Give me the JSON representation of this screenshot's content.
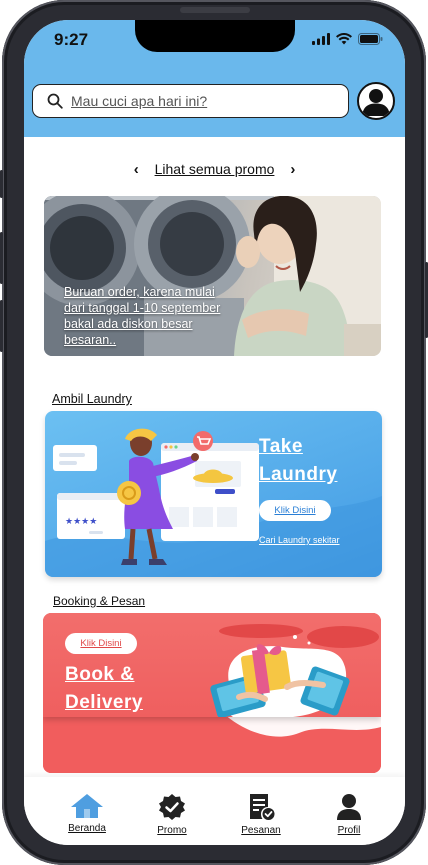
{
  "status_bar": {
    "time": "9:27"
  },
  "search": {
    "placeholder": "Mau cuci apa hari ini?"
  },
  "promo_nav": {
    "label": "Lihat semua promo",
    "prev": "‹",
    "next": "›"
  },
  "promo_banner": {
    "text": "Buruan order, karena mulai dari tanggal 1-10 september bakal ada diskon besar besaran.."
  },
  "sections": {
    "ambil": "Ambil Laundry",
    "booking": "Booking & Pesan"
  },
  "take_card": {
    "title_line1": "Take",
    "title_line2": "Laundry",
    "button": "Klik Disini",
    "link": "Cari Laundry sekitar"
  },
  "book_card": {
    "button": "Klik Disini",
    "title_line1": "Book &",
    "title_line2": "Delivery"
  },
  "bottom_nav": {
    "items": [
      {
        "label": "Beranda",
        "icon": "home-icon",
        "active": true
      },
      {
        "label": "Promo",
        "icon": "promo-badge-icon"
      },
      {
        "label": "Pesanan",
        "icon": "receipt-icon"
      },
      {
        "label": "Profil",
        "icon": "user-icon"
      }
    ]
  },
  "colors": {
    "header": "#6ab8ec",
    "take_card": "#4fa6e8",
    "book_card": "#f15d5d",
    "nav_active": "#4f9ee0"
  }
}
